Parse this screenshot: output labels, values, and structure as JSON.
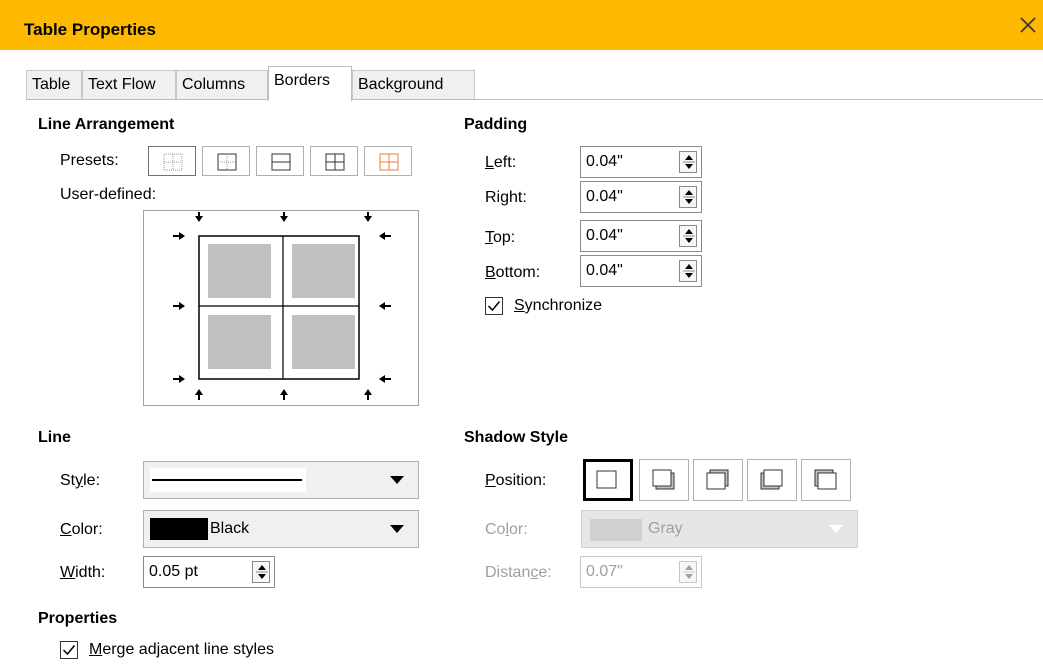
{
  "window": {
    "title": "Table Properties"
  },
  "tabs": [
    "Table",
    "Text Flow",
    "Columns",
    "Borders",
    "Background"
  ],
  "line_arrangement": {
    "heading": "Line Arrangement",
    "presets_label": "Presets:",
    "user_defined_label": "User-defined:"
  },
  "padding": {
    "heading": "Padding",
    "left_label": "Left:",
    "left_value": "0.04\"",
    "right_label": "Right:",
    "right_value": "0.04\"",
    "top_label": "Top:",
    "top_value": "0.04\"",
    "bottom_label": "Bottom:",
    "bottom_value": "0.04\"",
    "synchronize_label": "Synchronize",
    "synchronize_checked": true
  },
  "line": {
    "heading": "Line",
    "style_label": "Style:",
    "color_label": "Color:",
    "color_value": "Black",
    "color_swatch": "#000000",
    "width_label": "Width:",
    "width_value": "0.05 pt"
  },
  "shadow": {
    "heading": "Shadow Style",
    "position_label": "Position:",
    "color_label": "Color:",
    "color_value": "Gray",
    "color_swatch": "#c0c0c0",
    "distance_label": "Distance:",
    "distance_value": "0.07\""
  },
  "properties": {
    "heading": "Properties",
    "merge_label": "Merge adjacent line styles",
    "merge_checked": true
  },
  "colors": {
    "titlebar": "#FDB900",
    "preset_orange": "#E8813A"
  }
}
